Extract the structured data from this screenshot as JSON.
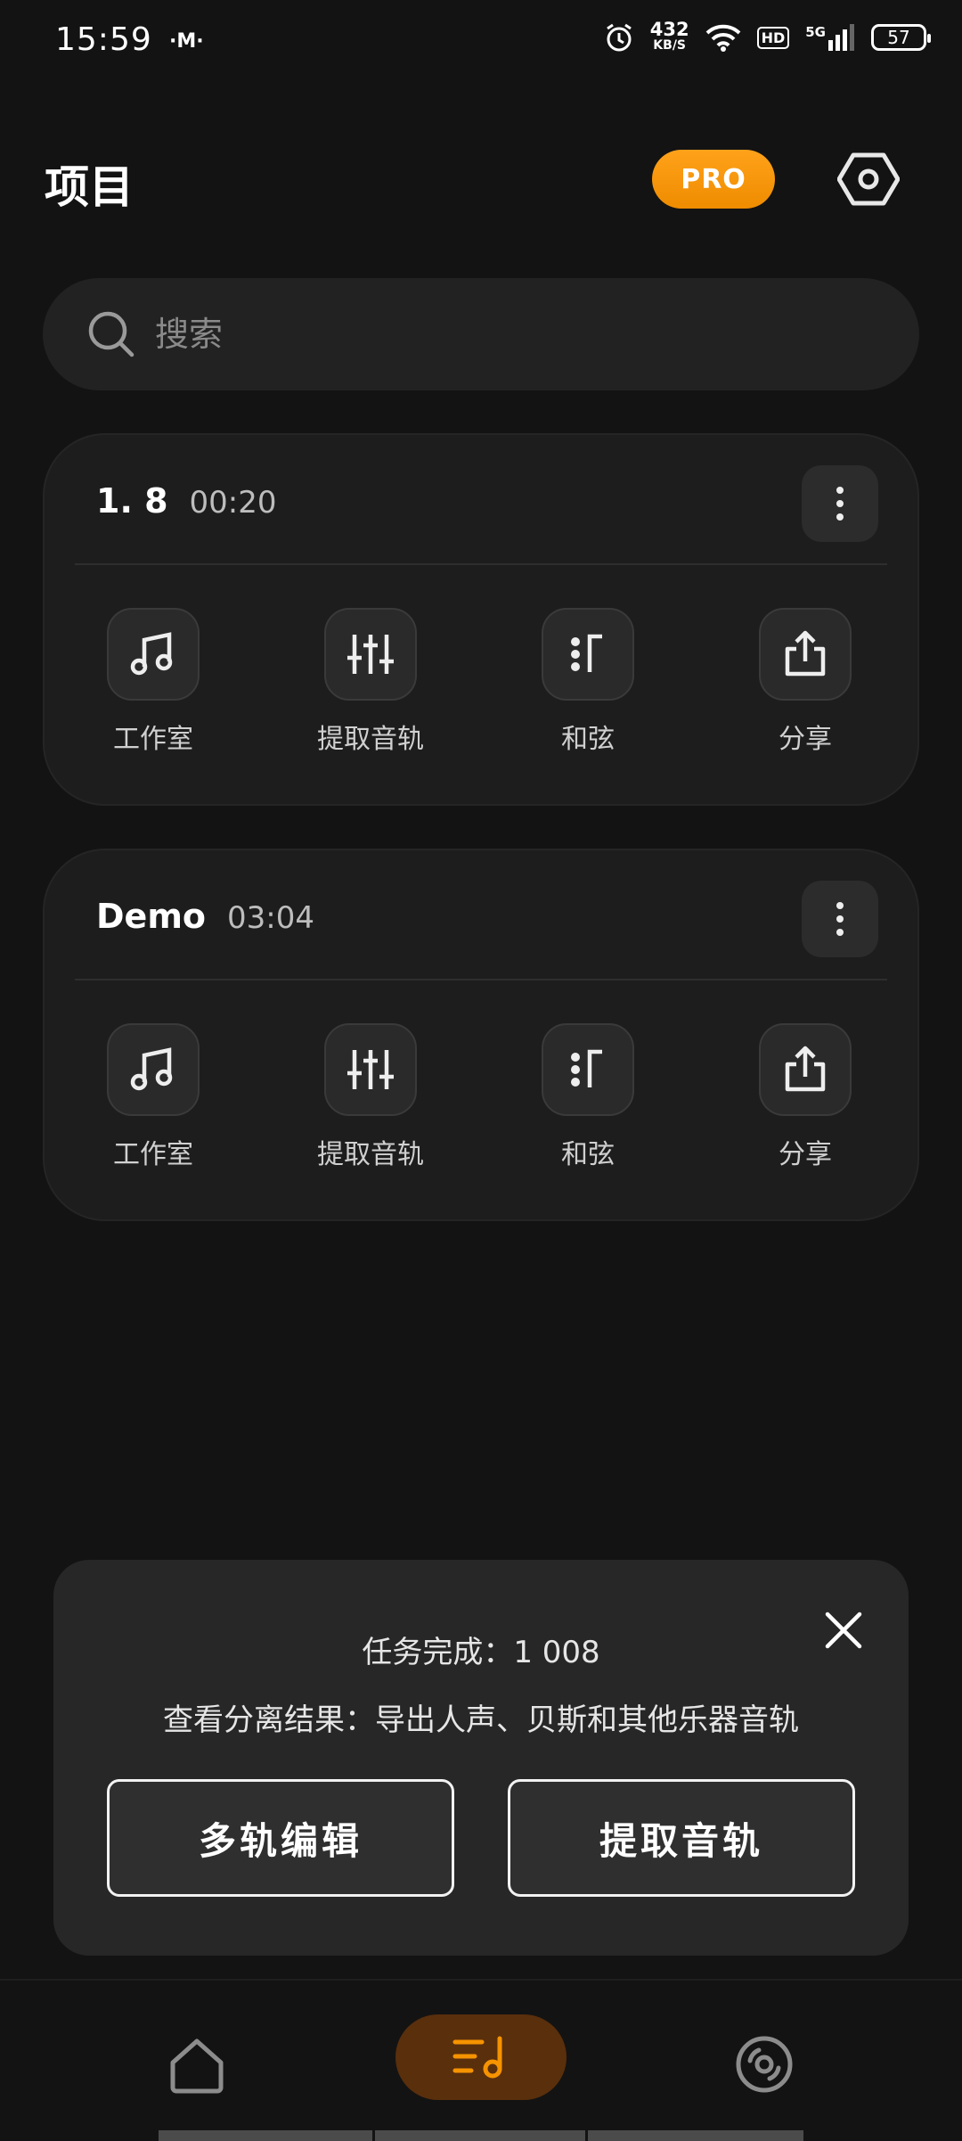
{
  "status_bar": {
    "time": "15:59",
    "m_icon": "·M·",
    "speed_value": "432",
    "speed_unit": "KB/S",
    "hd": "HD",
    "network": "5G",
    "battery": "57"
  },
  "header": {
    "title": "项目",
    "pro_label": "PRO"
  },
  "search": {
    "placeholder": "搜索"
  },
  "projects": [
    {
      "name": "1.          8",
      "duration": "00:20",
      "actions": [
        {
          "label": "工作室",
          "icon": "music-note-icon"
        },
        {
          "label": "提取音轨",
          "icon": "sliders-icon"
        },
        {
          "label": "和弦",
          "icon": "chord-icon"
        },
        {
          "label": "分享",
          "icon": "share-icon"
        }
      ]
    },
    {
      "name": "Demo",
      "duration": "03:04",
      "actions": [
        {
          "label": "工作室",
          "icon": "music-note-icon"
        },
        {
          "label": "提取音轨",
          "icon": "sliders-icon"
        },
        {
          "label": "和弦",
          "icon": "chord-icon"
        },
        {
          "label": "分享",
          "icon": "share-icon"
        }
      ]
    }
  ],
  "popup": {
    "title": "任务完成：1          008",
    "description": "查看分离结果：导出人声、贝斯和其他乐器音轨",
    "multitrack_label": "多轨编辑",
    "extract_label": "提取音轨"
  },
  "colors": {
    "accent": "#f59300",
    "nav_active_bg": "#5a2f0c",
    "background": "#131313"
  }
}
